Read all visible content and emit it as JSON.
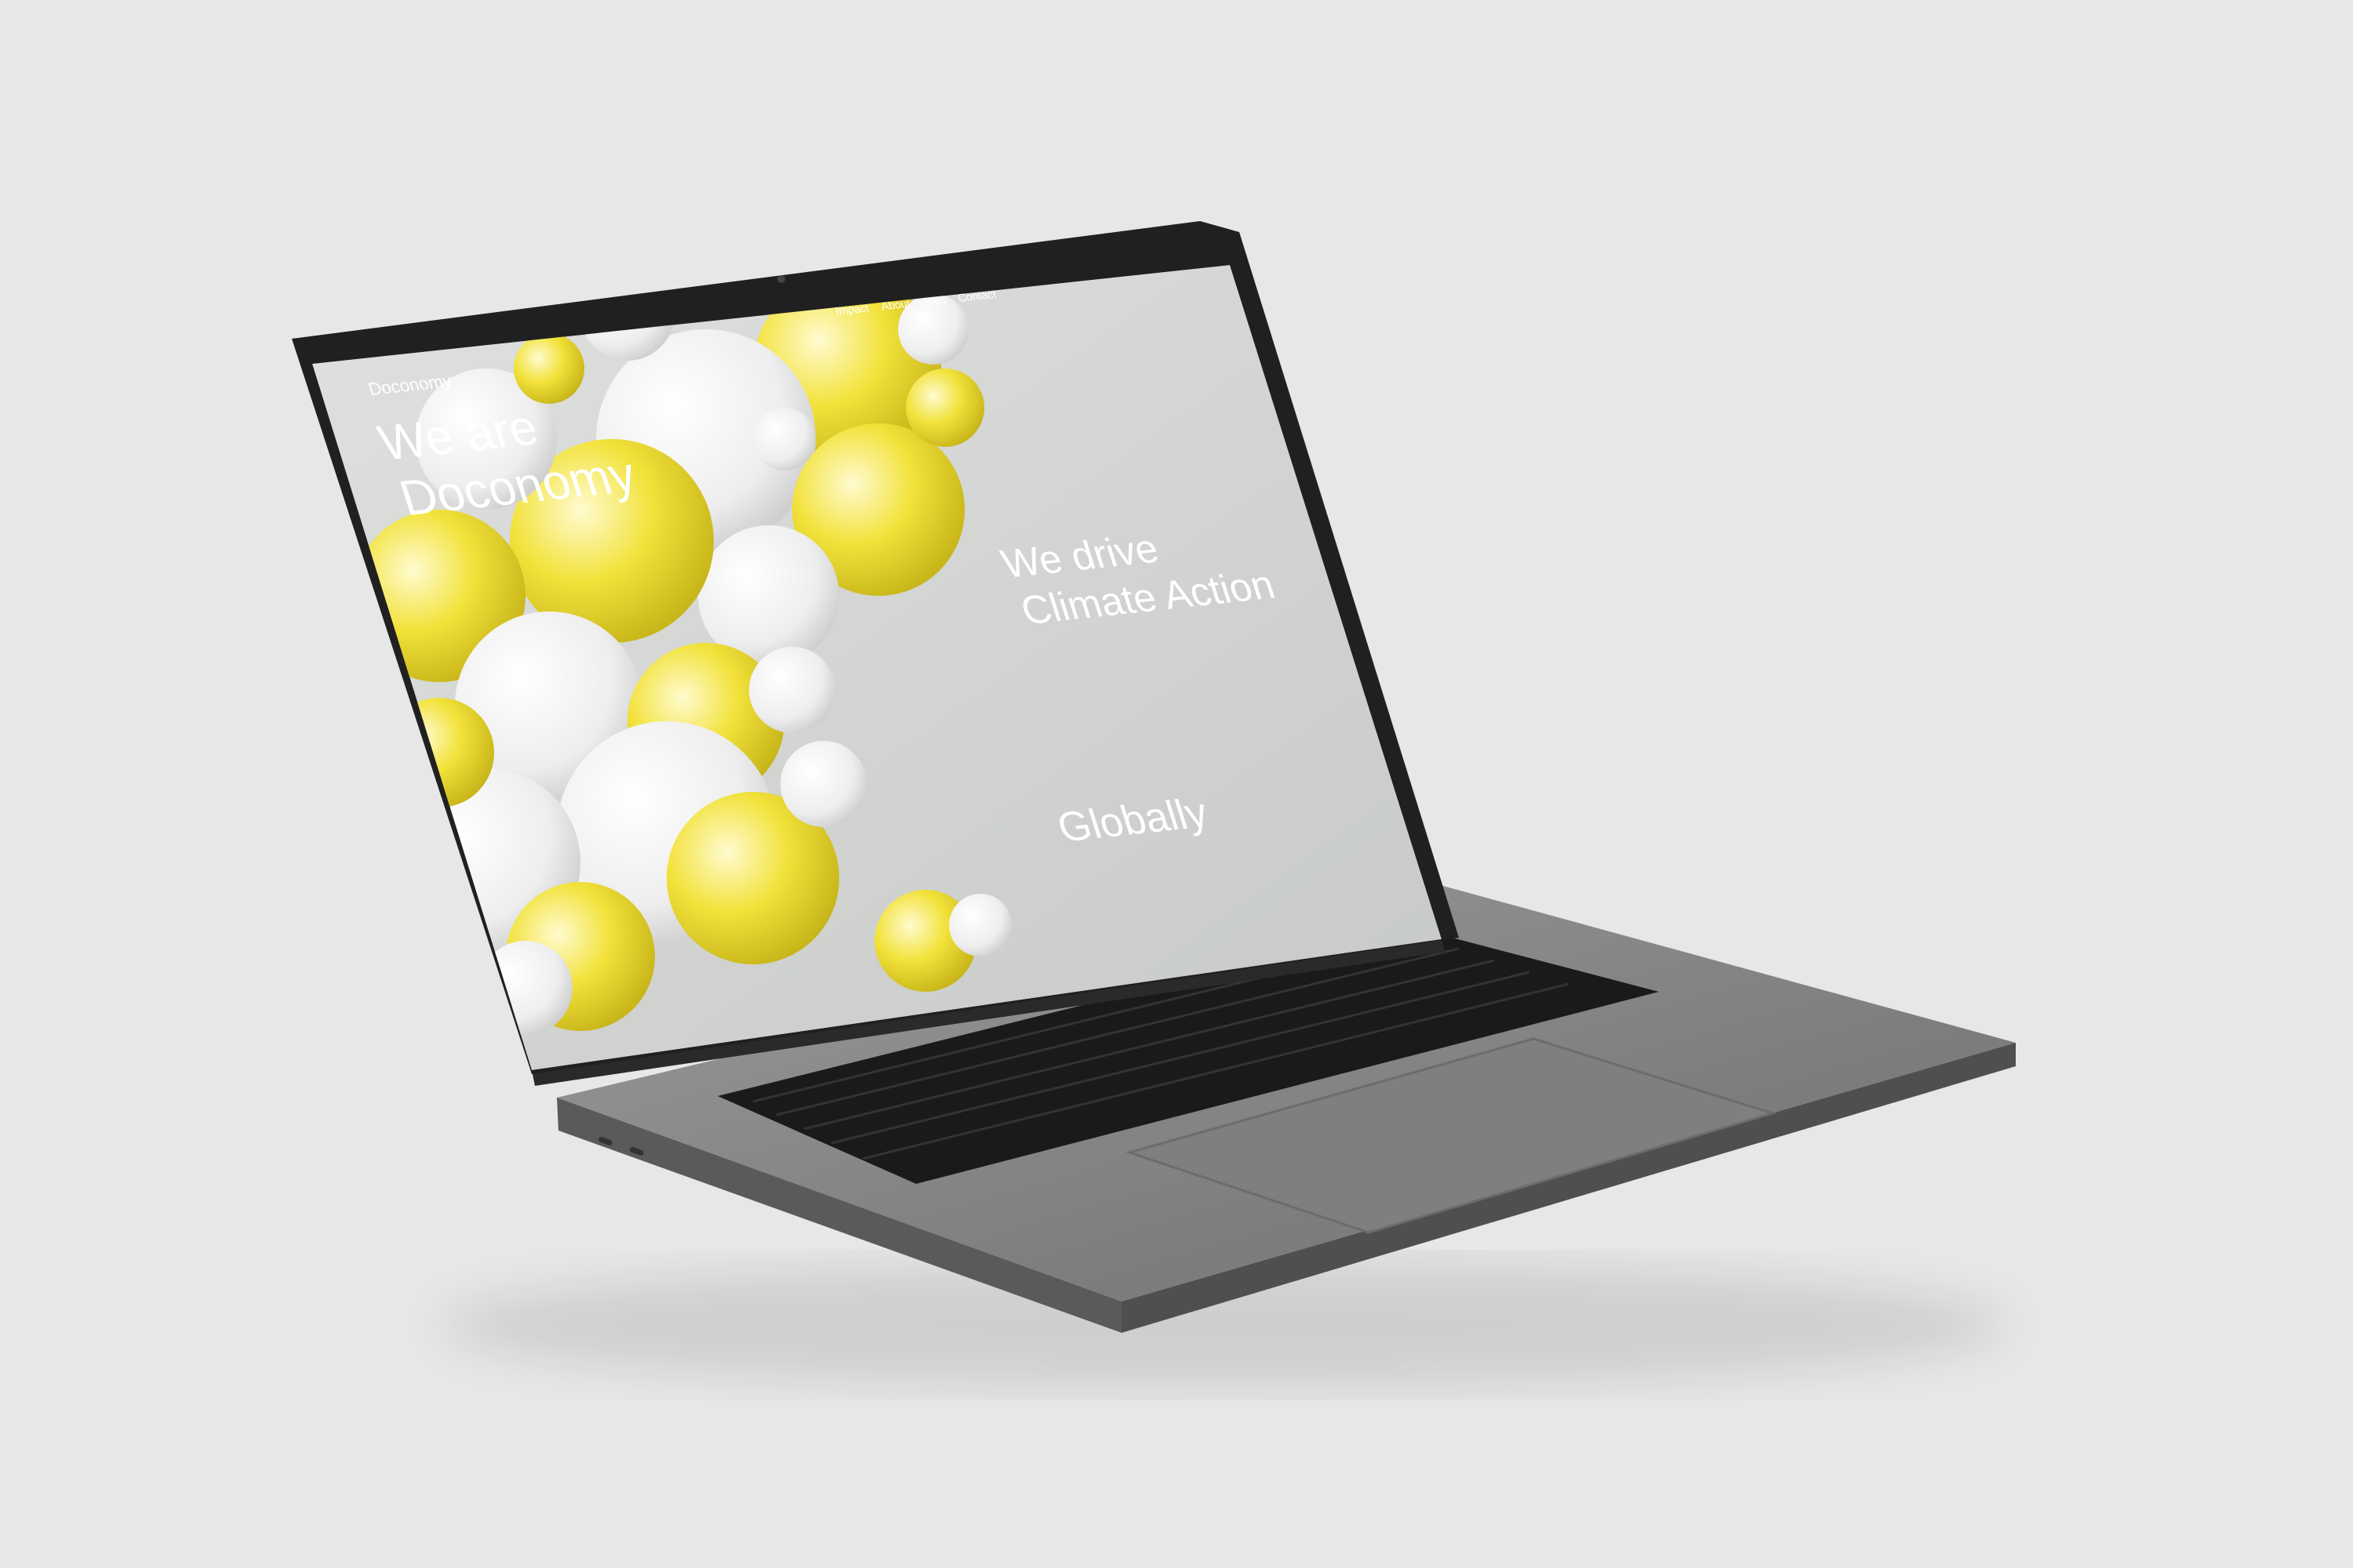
{
  "site": {
    "logo": "Doconomy",
    "nav": [
      "Impact",
      "About",
      "Jobs",
      "Contact"
    ],
    "hero_line1": "We are",
    "hero_line2": "Doconomy",
    "headline_line1": "We drive",
    "headline_line2": "Climate Action",
    "footer_word": "Globally"
  },
  "colors": {
    "background": "#e7e7e7",
    "screen_bg": "#d3d6d3",
    "accent_yellow": "#f2e23a",
    "text": "#ffffff"
  }
}
